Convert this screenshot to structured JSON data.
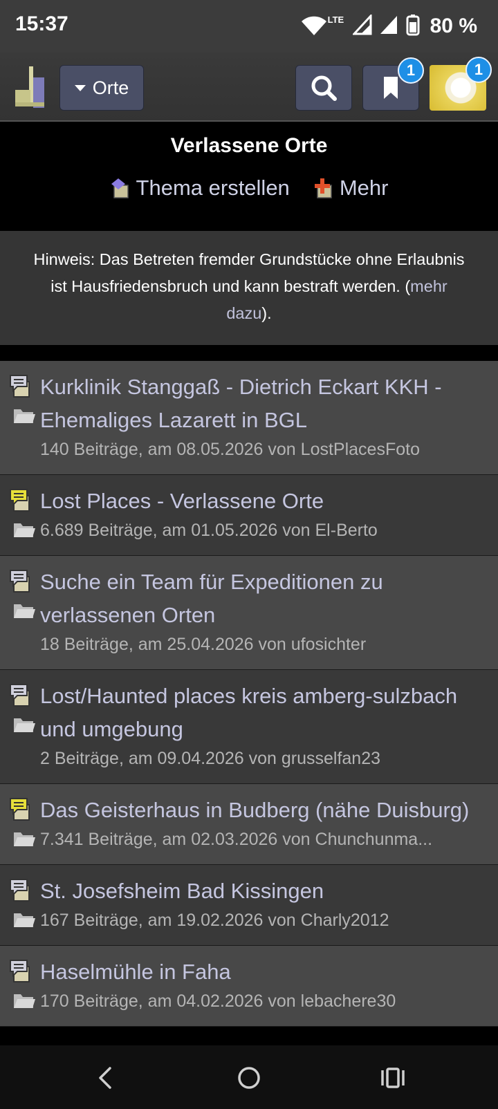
{
  "status": {
    "time": "15:37",
    "network": "LTE",
    "battery": "80 %"
  },
  "appbar": {
    "dropdown_label": "Orte",
    "bookmark_badge": "1",
    "avatar_badge": "1"
  },
  "forum": {
    "title": "Verlassene Orte",
    "create_topic_label": "Thema erstellen",
    "more_label": "Mehr"
  },
  "notice": {
    "text": "Hinweis: Das Betreten fremder Grundstücke ohne Erlaubnis ist Hausfriedensbruch und kann bestraft werden. (",
    "link": "mehr dazu",
    "suffix": ")."
  },
  "threads": [
    {
      "title": "Kurklinik Stanggaß - Dietrich Eckart KKH - Ehemaliges Lazarett in BGL",
      "meta": "140 Beiträge, am 08.05.2026 von LostPlacesFoto",
      "icon": "topic-icon-gray"
    },
    {
      "title": "Lost Places - Verlassene Orte",
      "meta": "6.689 Beiträge, am 01.05.2026 von El-Berto",
      "icon": "topic-icon-yellow"
    },
    {
      "title": "Suche ein Team für Expeditionen zu verlassenen Orten",
      "meta": "18 Beiträge, am 25.04.2026 von ufosichter",
      "icon": "topic-icon-gray"
    },
    {
      "title": "Lost/Haunted places kreis amberg-sulzbach und umgebung",
      "meta": "2 Beiträge, am 09.04.2026 von grusselfan23",
      "icon": "topic-icon-gray"
    },
    {
      "title": "Das Geisterhaus in Budberg (nähe Duisburg)",
      "meta": "7.341 Beiträge, am 02.03.2026 von Chunchunma...",
      "icon": "topic-icon-yellow"
    },
    {
      "title": "St. Josefsheim Bad Kissingen",
      "meta": "167 Beiträge, am 19.02.2026 von Charly2012",
      "icon": "topic-icon-gray"
    },
    {
      "title": "Haselmühle in Faha",
      "meta": "170 Beiträge, am 04.02.2026 von lebachere30",
      "icon": "topic-icon-gray"
    }
  ],
  "colors": {
    "link": "#c5c6e0",
    "button_bg": "#4a4f66",
    "badge": "#1e8fe6",
    "row_light": "#484848",
    "row_dark": "#393939"
  }
}
